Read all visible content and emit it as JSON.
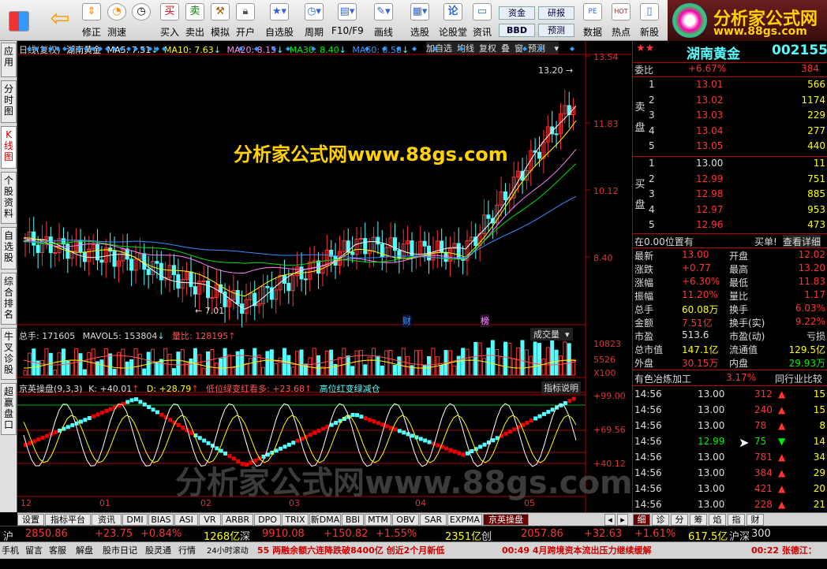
{
  "toolbar": {
    "buttons": [
      {
        "label": "",
        "icon": "grid-icon"
      },
      {
        "label": "",
        "icon": "back-arrow-icon"
      },
      {
        "label": "修正",
        "icon": "up-down-icon"
      },
      {
        "label": "测速",
        "icon": "speed-icon"
      },
      {
        "label": "",
        "icon": "clock-icon"
      },
      {
        "label": "买入",
        "icon": "buy-icon",
        "glyph": "买"
      },
      {
        "label": "卖出",
        "icon": "sell-icon",
        "glyph": "卖"
      },
      {
        "label": "模拟",
        "icon": "hammer-icon"
      },
      {
        "label": "开户",
        "icon": "lock-icon"
      },
      {
        "label": "自选股",
        "icon": "star-icon"
      },
      {
        "label": "周期",
        "icon": "period-icon"
      },
      {
        "label": "F10/F9",
        "icon": "f10-icon"
      },
      {
        "label": "画线",
        "icon": "pen-icon"
      },
      {
        "label": "选股",
        "icon": "select-icon"
      },
      {
        "label": "论股堂",
        "icon": "forum-icon",
        "glyph": "论"
      },
      {
        "label": "资讯",
        "icon": "news-icon"
      },
      {
        "label": "数据",
        "icon": "data-icon",
        "glyph": "PE"
      },
      {
        "label": "热点",
        "icon": "hot-icon",
        "glyph": "HOT"
      },
      {
        "label": "新股",
        "icon": "newstock-icon"
      }
    ],
    "text_buttons": [
      "资金",
      "研报",
      "BBD",
      "预测"
    ]
  },
  "logo": {
    "title": "分析家公式网",
    "url": "www.88gs.com"
  },
  "left_tabs": [
    "应用",
    "分时图",
    "K线图",
    "个股资料",
    "自选股",
    "综合排名",
    "牛叉诊股",
    "超赢盘口"
  ],
  "chart": {
    "info": {
      "period": "日线(复权)",
      "name": "湖南黄金",
      "ma5": "MA5: 7.51",
      "ma10": "MA10: 7.63",
      "ma20": "MA20: 8.15",
      "ma30": "MA30: 8.40",
      "ma60": "MA60: 8.58"
    },
    "toolbar": [
      "加自选",
      "均线",
      "复权",
      "叠",
      "窗",
      "预测"
    ],
    "watermark_top": "分析家公式网www.88gs.com",
    "watermark_bottom": "分析家公式网www.88gs.com",
    "price_axis": [
      "13.54",
      "11.83",
      "10.12",
      "8.40"
    ],
    "high_label": "13.20",
    "low_label": "7.01",
    "markers": [
      "财",
      "榜"
    ],
    "vol_info": {
      "total": "总手: 171605",
      "mavol5": "MAVOL5: 153804",
      "ratio": "量比: 128195"
    },
    "vol_select": "成交量",
    "vol_axis": [
      "10823",
      "5526",
      "X100"
    ],
    "ind_info": {
      "name": "京英操盘(9,3,3)",
      "k": "K: +40.01",
      "d": "D: +28.79",
      "low": "低位绿变红看多: +23.68",
      "high": "高位红变绿减仓"
    },
    "ind_button": "指标说明",
    "ind_axis": [
      "+99.00",
      "+69.56",
      "+40.12"
    ],
    "x_axis": [
      "12",
      "01",
      "02",
      "03",
      "04",
      "05"
    ]
  },
  "chart_data": [
    {
      "type": "line",
      "title": "湖南黄金",
      "x": [
        "12",
        "01",
        "02",
        "03",
        "04",
        "05"
      ],
      "series": [
        {
          "name": "MA5",
          "values": [
            8.9,
            8.4,
            7.3,
            8.8,
            8.6,
            12.4
          ]
        },
        {
          "name": "MA10",
          "values": [
            8.9,
            8.5,
            7.6,
            8.6,
            8.5,
            12.0
          ]
        },
        {
          "name": "MA20",
          "values": [
            8.9,
            8.7,
            8.1,
            8.4,
            8.5,
            11.2
          ]
        },
        {
          "name": "MA30",
          "values": [
            8.9,
            8.8,
            8.3,
            8.4,
            8.5,
            10.8
          ]
        },
        {
          "name": "MA60",
          "values": [
            8.9,
            8.9,
            8.6,
            8.5,
            8.5,
            10.0
          ]
        }
      ],
      "ylim": [
        7.0,
        13.54
      ]
    }
  ],
  "quote": {
    "name": "湖南黄金",
    "code": "002155",
    "weibi_label": "委比",
    "weibi": "+6.67%",
    "weicha": "384",
    "sell_label": "卖盘",
    "sell": [
      [
        "5",
        "13.05",
        "440"
      ],
      [
        "4",
        "13.04",
        "277"
      ],
      [
        "3",
        "13.03",
        "229"
      ],
      [
        "2",
        "13.02",
        "1174"
      ],
      [
        "1",
        "13.01",
        "566"
      ]
    ],
    "buy_label": "买盘",
    "buy": [
      [
        "1",
        "13.00",
        "11"
      ],
      [
        "2",
        "12.99",
        "751"
      ],
      [
        "3",
        "12.98",
        "885"
      ],
      [
        "4",
        "12.97",
        "953"
      ],
      [
        "5",
        "12.96",
        "473"
      ]
    ],
    "position": "在0.00位置有",
    "buyone": "买单!",
    "detail": "查看详细",
    "stats": [
      [
        "最新",
        "13.00",
        "开盘",
        "12.02"
      ],
      [
        "涨跌",
        "+0.77",
        "最高",
        "13.20"
      ],
      [
        "涨幅",
        "+6.30%",
        "最低",
        "11.83"
      ],
      [
        "振幅",
        "11.20%",
        "量比",
        "1.17"
      ],
      [
        "总手",
        "60.08万",
        "换手",
        "6.03%"
      ],
      [
        "金额",
        "7.51亿",
        "换手(实)",
        "9.22%"
      ],
      [
        "市盈",
        "513.6",
        "市盈(动)",
        "亏损"
      ],
      [
        "总市值",
        "147.1亿",
        "流通值",
        "129.5亿"
      ],
      [
        "外盘",
        "30.15万",
        "内盘",
        "29.93万"
      ]
    ],
    "industry": "有色冶炼加工",
    "industry_pct": "3.17%",
    "industry_cmp": "同行业比较",
    "ticks": [
      [
        "14:56",
        "13.00",
        "312",
        "15"
      ],
      [
        "14:56",
        "13.00",
        "240",
        "15"
      ],
      [
        "14:56",
        "13.00",
        "78",
        "8"
      ],
      [
        "14:56",
        "12.99",
        "75",
        "14"
      ],
      [
        "14:56",
        "13.00",
        "781",
        "34"
      ],
      [
        "14:56",
        "13.00",
        "384",
        "29"
      ],
      [
        "14:56",
        "13.00",
        "421",
        "20"
      ],
      [
        "14:56",
        "13.00",
        "228",
        "21"
      ]
    ],
    "tabs": [
      "细",
      "诊",
      "分",
      "筹",
      "焰",
      "指",
      "财"
    ]
  },
  "bottom_tabs": [
    "设置",
    "指标平台",
    "资讯",
    "DMI",
    "BIAS",
    "ASI",
    "VR",
    "ARBR",
    "DPO",
    "TRIX",
    "新DMA",
    "BBI",
    "MTM",
    "OBV",
    "SAR",
    "EXPMA",
    "京英操盘"
  ],
  "ticker": {
    "sh_label": "沪",
    "sh_index": "2850.86",
    "sh_chg": "+23.75",
    "sh_pct": "+0.84%",
    "sh_amt": "1268亿",
    "sz_label": "深",
    "sz_index": "9910.08",
    "sz_chg": "+150.82",
    "sz_pct": "+1.55%",
    "sz_amt": "2351亿",
    "cy_label": "创",
    "cy_index": "2057.86",
    "cy_chg": "+32.63",
    "cy_pct": "+1.61%",
    "hs_amt": "617.5亿",
    "hs_label": "沪深",
    "hs_val": "300"
  },
  "status": {
    "items": [
      "手机",
      "留言",
      "客服",
      "解盘",
      "股市日记",
      "股灵通",
      "行情"
    ],
    "scroll_label": "24小时滚动",
    "news1": "55 两融余额六连降跌破8400亿 创近2个月新低",
    "news2": "00:49 4月跨境资本流出压力继续缓解",
    "news3": "00:22 张德江："
  },
  "colors": {
    "up": "#ff3333",
    "down": "#54ffff",
    "ma5": "#ffffff",
    "ma10": "#ffff00",
    "ma20": "#ff80ff",
    "ma30": "#00e000",
    "ma60": "#3090ff",
    "panel_red": "#b00000"
  }
}
